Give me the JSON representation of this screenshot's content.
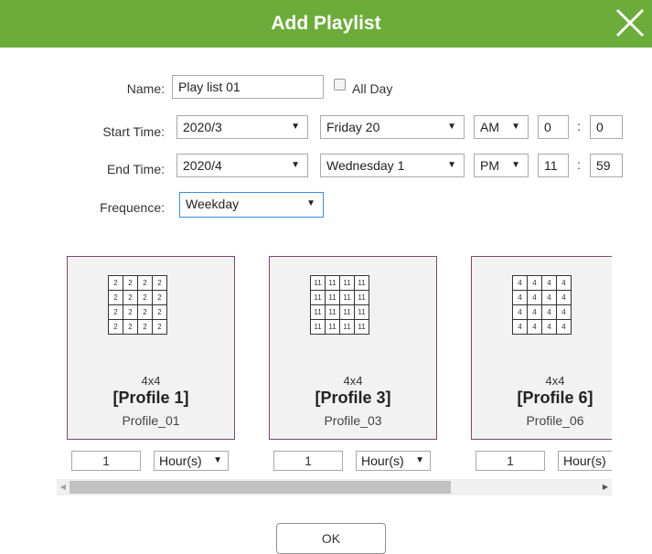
{
  "dialog": {
    "title": "Add Playlist"
  },
  "form": {
    "name_label": "Name:",
    "name_value": "Play list 01",
    "allday_label": "All Day",
    "allday_checked": false,
    "start_label": "Start Time:",
    "start": {
      "month": "2020/3",
      "day": "Friday 20",
      "ampm": "AM",
      "hour": "0",
      "minute": "0"
    },
    "end_label": "End Time:",
    "end": {
      "month": "2020/4",
      "day": "Wednesday 1",
      "ampm": "PM",
      "hour": "11",
      "minute": "59"
    },
    "frequence_label": "Frequence:",
    "frequence_value": "Weekday",
    "colon": ":"
  },
  "profiles": [
    {
      "cell": "2",
      "layout": "4x4",
      "name": "[Profile 1]",
      "id": "Profile_01",
      "duration": "1",
      "unit": "Hour(s)"
    },
    {
      "cell": "11",
      "layout": "4x4",
      "name": "[Profile 3]",
      "id": "Profile_03",
      "duration": "1",
      "unit": "Hour(s)"
    },
    {
      "cell": "4",
      "layout": "4x4",
      "name": "[Profile 6]",
      "id": "Profile_06",
      "duration": "1",
      "unit": "Hour(s)"
    }
  ],
  "scroll": {
    "position_fraction": 0.0
  },
  "ok_label": "OK",
  "colors": {
    "header": "#6cac3a",
    "card_border": "#7a4a6e"
  }
}
